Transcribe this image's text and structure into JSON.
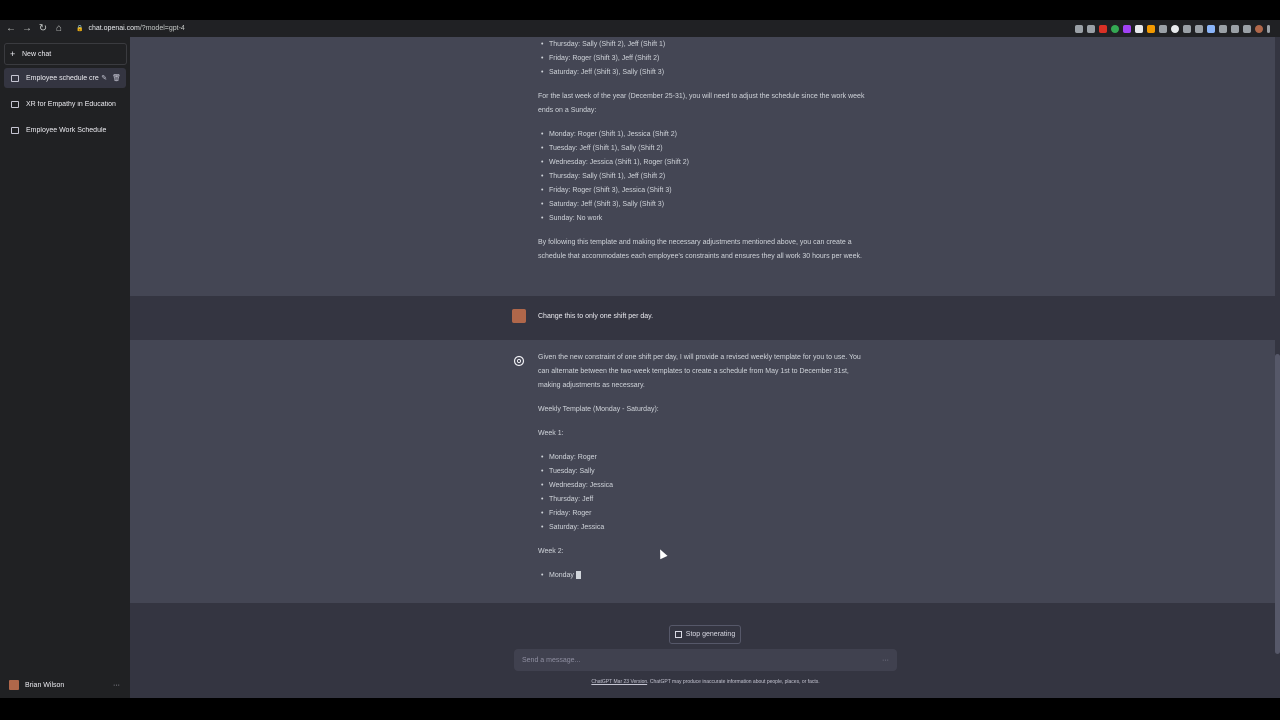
{
  "browser": {
    "url_host": "chat.openai.com",
    "url_path": "/?model=gpt-4"
  },
  "sidebar": {
    "new_chat": "New chat",
    "chats": [
      {
        "title": "Employee schedule cre"
      },
      {
        "title": "XR for Empathy in Education"
      },
      {
        "title": "Employee Work Schedule"
      }
    ],
    "user_name": "Brian Wilson"
  },
  "conversation": {
    "top_list1": [
      "Thursday: Sally (Shift 2), Jeff (Shift 1)",
      "Friday: Roger (Shift 3), Jeff (Shift 2)",
      "Saturday: Jeff (Shift 3), Sally (Shift 3)"
    ],
    "top_para1": "For the last week of the year (December 25-31), you will need to adjust the schedule since the work week ends on a Sunday:",
    "top_list2": [
      "Monday: Roger (Shift 1), Jessica (Shift 2)",
      "Tuesday: Jeff (Shift 1), Sally (Shift 2)",
      "Wednesday: Jessica (Shift 1), Roger (Shift 2)",
      "Thursday: Sally (Shift 1), Jeff (Shift 2)",
      "Friday: Roger (Shift 3), Jessica (Shift 3)",
      "Saturday: Jeff (Shift 3), Sally (Shift 3)",
      "Sunday: No work"
    ],
    "top_para2": "By following this template and making the necessary adjustments mentioned above, you can create a schedule that accommodates each employee's constraints and ensures they all work 30 hours per week.",
    "user_message": "Change this to only one shift per day.",
    "reply_para1": "Given the new constraint of one shift per day, I will provide a revised weekly template for you to use. You can alternate between the two-week templates to create a schedule from May 1st to December 31st, making adjustments as necessary.",
    "reply_heading": "Weekly Template (Monday - Saturday):",
    "week1_label": "Week 1:",
    "week1_list": [
      "Monday: Roger",
      "Tuesday: Sally",
      "Wednesday: Jessica",
      "Thursday: Jeff",
      "Friday: Roger",
      "Saturday: Jessica"
    ],
    "week2_label": "Week 2:",
    "week2_partial": "Monday"
  },
  "composer": {
    "stop_label": "Stop generating",
    "placeholder": "Send a message...",
    "footer_link": "ChatGPT Mar 23 Version",
    "footer_text": ". ChatGPT may produce inaccurate information about people, places, or facts."
  }
}
